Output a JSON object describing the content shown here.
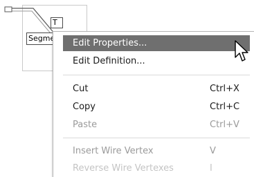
{
  "diagram": {
    "port_label": "T",
    "segment_label": "Segment"
  },
  "context_menu": {
    "items": [
      {
        "label": "Edit Properties...",
        "shortcut": "",
        "state": "highlighted"
      },
      {
        "label": "Edit Definition...",
        "shortcut": "",
        "state": "enabled"
      },
      {
        "label": "Cut",
        "shortcut": "Ctrl+X",
        "state": "enabled"
      },
      {
        "label": "Copy",
        "shortcut": "Ctrl+C",
        "state": "enabled"
      },
      {
        "label": "Paste",
        "shortcut": "Ctrl+V",
        "state": "disabled"
      },
      {
        "label": "Insert Wire Vertex",
        "shortcut": "V",
        "state": "disabled"
      },
      {
        "label": "Reverse Wire Vertexes",
        "shortcut": "I",
        "state": "disabled"
      }
    ]
  },
  "colors": {
    "highlight": "#6f6f6f",
    "disabled_text": "#9a9a9a"
  },
  "cursor": {
    "icon": "arrow-pointer-icon"
  }
}
